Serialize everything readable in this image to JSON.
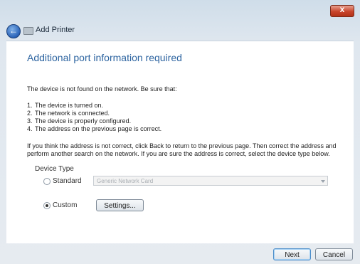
{
  "window": {
    "title": "Add Printer",
    "back_icon": "back-arrow-icon",
    "printer_icon": "printer-icon",
    "close_icon": "close-icon"
  },
  "content": {
    "heading": "Additional port information required",
    "intro": "The device is not found on the network.  Be sure that:",
    "checklist": [
      {
        "num": "1.",
        "text": "The device is turned on."
      },
      {
        "num": "2.",
        "text": "The network is connected."
      },
      {
        "num": "3.",
        "text": "The device is properly configured."
      },
      {
        "num": "4.",
        "text": "The address on the previous page is correct."
      }
    ],
    "guidance": "If you think the address is not correct, click Back to return to the previous page.  Then correct the address and perform another search on the network.  If you are sure the address is correct, select the device type below.",
    "device_type": {
      "label": "Device Type",
      "standard_label": "Standard",
      "standard_selected": false,
      "standard_dropdown_value": "Generic Network Card",
      "custom_label": "Custom",
      "custom_selected": true,
      "settings_label": "Settings..."
    }
  },
  "footer": {
    "next_label": "Next",
    "cancel_label": "Cancel"
  },
  "colors": {
    "heading": "#2d64a0",
    "close_button": "#c8442b"
  }
}
